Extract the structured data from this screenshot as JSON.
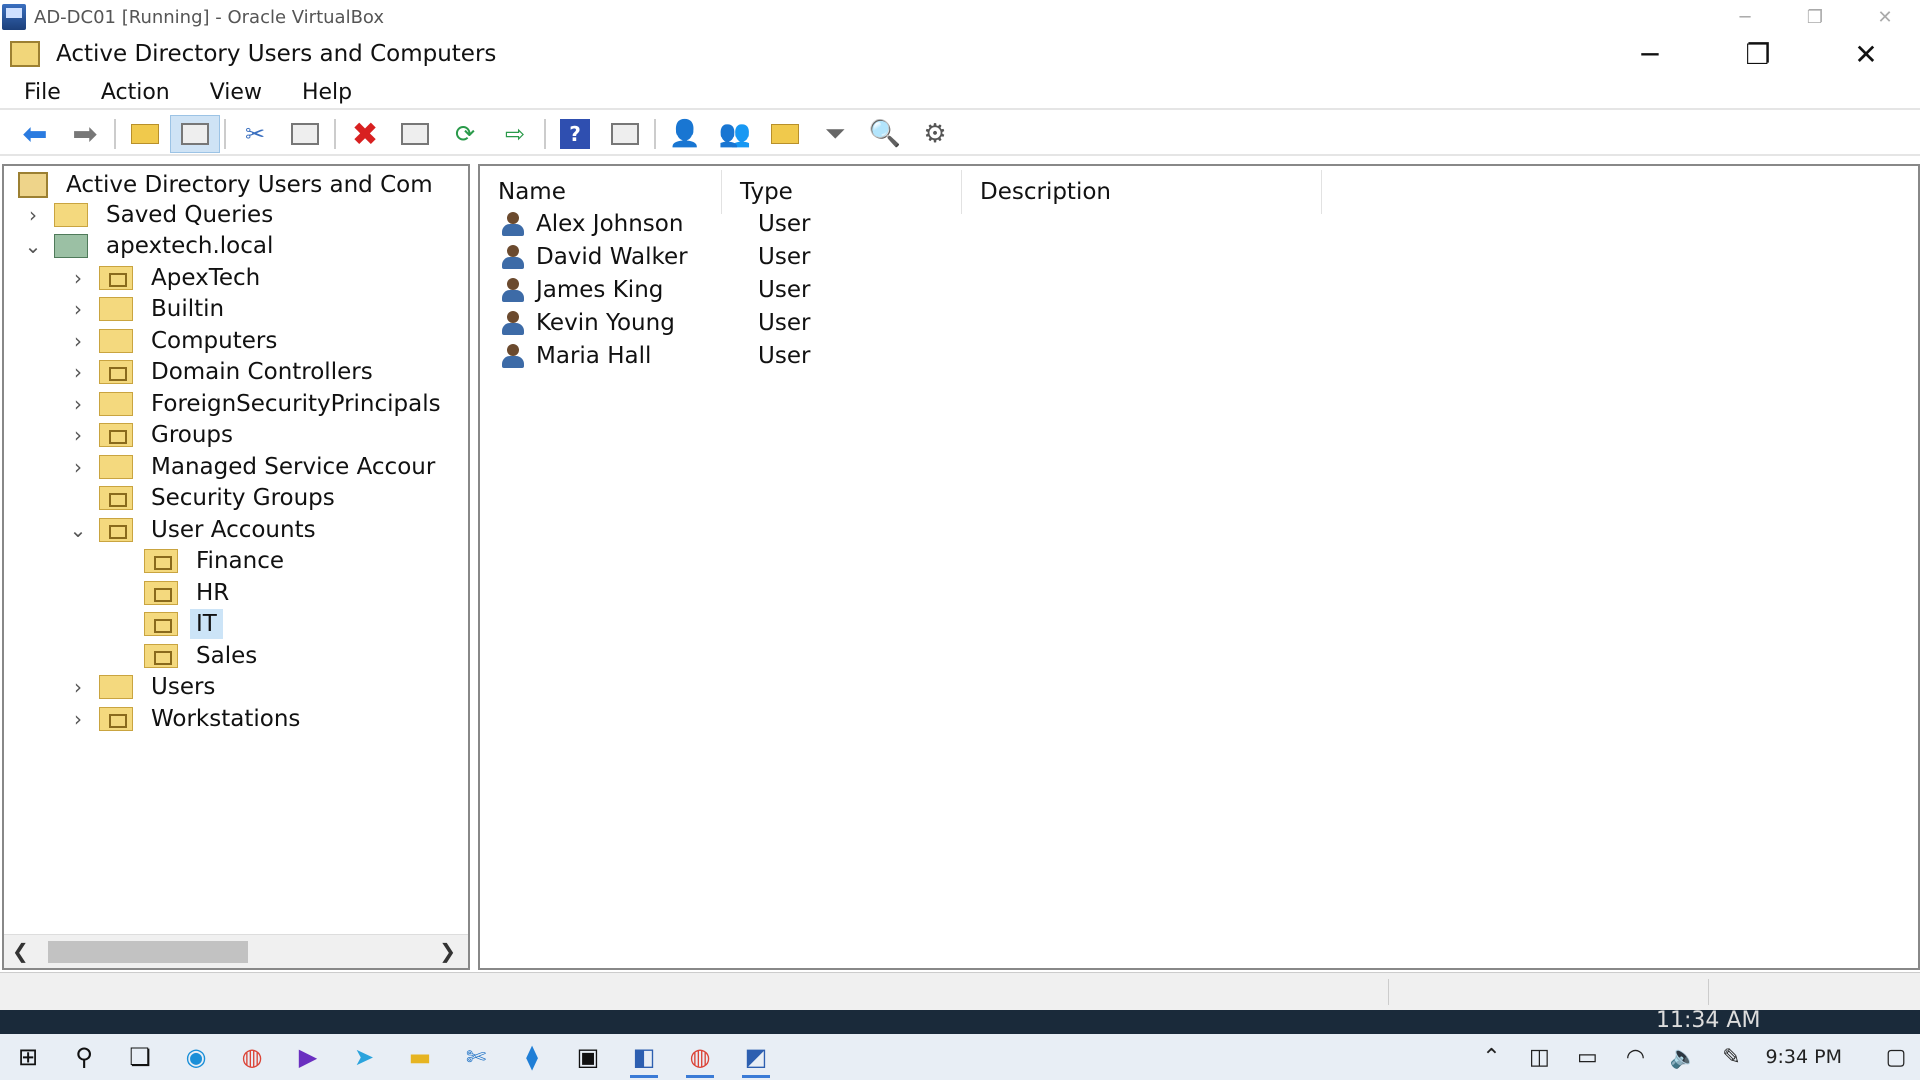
{
  "vbox": {
    "title": "AD-DC01 [Running] - Oracle VirtualBox"
  },
  "app": {
    "title": "Active Directory Users and Computers"
  },
  "menu": [
    "File",
    "Action",
    "View",
    "Help"
  ],
  "toolbar_icons": [
    "back-icon",
    "forward-icon",
    "up-folder-icon",
    "show-hide-tree-icon",
    "cut-icon",
    "paste-icon",
    "delete-icon",
    "properties-icon",
    "refresh-icon",
    "export-list-icon",
    "help-icon",
    "action-pane-icon",
    "new-user-icon",
    "new-group-icon",
    "new-ou-icon",
    "filter-icon",
    "find-icon",
    "add-to-group-icon"
  ],
  "tree": {
    "root": "Active Directory Users and Com",
    "saved_queries": "Saved Queries",
    "domain": "apextech.local",
    "items": [
      {
        "label": "ApexTech",
        "type": "ou",
        "expandable": true
      },
      {
        "label": "Builtin",
        "type": "container",
        "expandable": true
      },
      {
        "label": "Computers",
        "type": "container",
        "expandable": true
      },
      {
        "label": "Domain Controllers",
        "type": "ou",
        "expandable": true
      },
      {
        "label": "ForeignSecurityPrincipals",
        "type": "container",
        "expandable": true
      },
      {
        "label": "Groups",
        "type": "ou",
        "expandable": true
      },
      {
        "label": "Managed Service Accour",
        "type": "container",
        "expandable": true
      },
      {
        "label": "Security Groups",
        "type": "ou",
        "expandable": false
      },
      {
        "label": "User Accounts",
        "type": "ou",
        "expandable": true,
        "expanded": true
      },
      {
        "label": "Users",
        "type": "container",
        "expandable": true
      },
      {
        "label": "Workstations",
        "type": "ou",
        "expandable": true
      }
    ],
    "user_accounts_children": [
      "Finance",
      "HR",
      "IT",
      "Sales"
    ],
    "selected": "IT"
  },
  "list": {
    "columns": [
      "Name",
      "Type",
      "Description"
    ],
    "rows": [
      {
        "name": "Alex Johnson",
        "type": "User",
        "description": ""
      },
      {
        "name": "David Walker",
        "type": "User",
        "description": ""
      },
      {
        "name": "James King",
        "type": "User",
        "description": ""
      },
      {
        "name": "Kevin Young",
        "type": "User",
        "description": ""
      },
      {
        "name": "Maria Hall",
        "type": "User",
        "description": ""
      }
    ]
  },
  "host": {
    "clock_partial": "11:34 AM"
  },
  "taskbar": {
    "time": "9:34 PM",
    "apps": [
      "start-icon",
      "search-icon",
      "task-view-icon",
      "edge-icon",
      "chrome-icon",
      "video-editor-icon",
      "telegram-icon",
      "file-explorer-icon",
      "snipping-tool-icon",
      "vscode-icon",
      "terminal-icon",
      "visio-icon",
      "chrome-profile-icon",
      "virtualbox-icon"
    ]
  }
}
